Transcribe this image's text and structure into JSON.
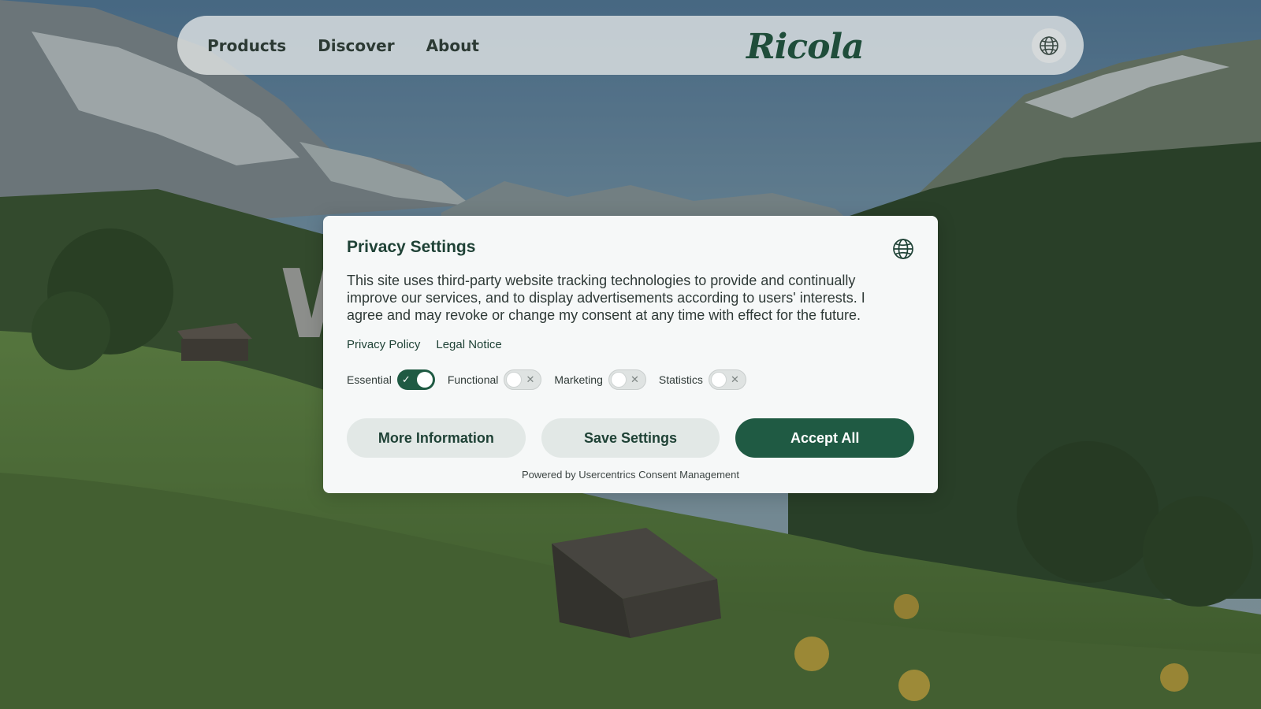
{
  "nav": {
    "links": [
      "Products",
      "Discover",
      "About"
    ],
    "brand": "Ricola",
    "language_icon": "globe-icon"
  },
  "hero": {
    "headline_partial": "W                  r"
  },
  "consent": {
    "title": "Privacy Settings",
    "language_icon": "globe-icon",
    "description": "This site uses third-party website tracking technologies to provide and continually improve our services, and to display advertisements according to users' interests. I agree and may revoke or change my consent at any time with effect for the future.",
    "links": {
      "privacy_policy": "Privacy Policy",
      "legal_notice": "Legal Notice"
    },
    "categories": [
      {
        "label": "Essential",
        "enabled": true
      },
      {
        "label": "Functional",
        "enabled": false
      },
      {
        "label": "Marketing",
        "enabled": false
      },
      {
        "label": "Statistics",
        "enabled": false
      }
    ],
    "buttons": {
      "more_info": "More Information",
      "save": "Save Settings",
      "accept_all": "Accept All"
    },
    "powered_by": "Powered by Usercentrics Consent Management"
  },
  "colors": {
    "brand_green": "#1f5a43",
    "dark_green_text": "#1f4236",
    "modal_bg": "#f6f8f8",
    "secondary_button": "#e2e8e6"
  }
}
